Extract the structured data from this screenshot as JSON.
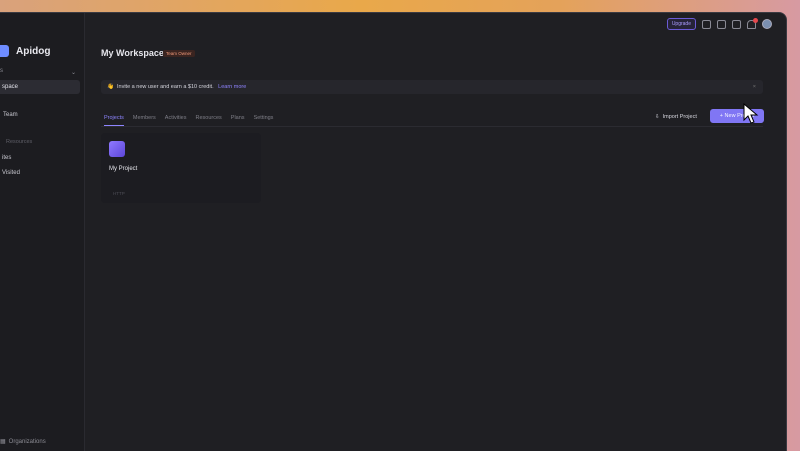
{
  "app": {
    "name": "Apidog"
  },
  "sidebar": {
    "top_label": "s",
    "items": [
      {
        "label": "space",
        "active": true
      },
      {
        "label": "Team",
        "active": false
      }
    ],
    "section_label": "Resources",
    "lower_items": [
      {
        "label": "ites"
      },
      {
        "label": "Visited"
      }
    ],
    "footer": "Organizations"
  },
  "topbar": {
    "upgrade_label": "Upgrade"
  },
  "workspace": {
    "title": "My Workspace",
    "badge": "Team Owner"
  },
  "invite": {
    "emoji": "👋",
    "message": "Invite a new user and earn a $10 credit.",
    "link": "Learn more"
  },
  "tabs": [
    {
      "label": "Projects",
      "active": true
    },
    {
      "label": "Members"
    },
    {
      "label": "Activities"
    },
    {
      "label": "Resources"
    },
    {
      "label": "Plans"
    },
    {
      "label": "Settings"
    }
  ],
  "actions": {
    "import_label": "Import Project",
    "new_label": "+ New Project"
  },
  "project_card": {
    "title": "My Project",
    "tag": "HTTP"
  }
}
